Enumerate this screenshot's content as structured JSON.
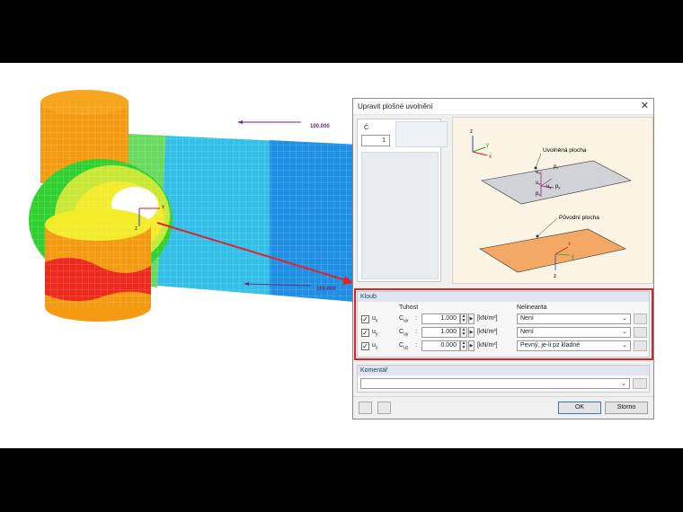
{
  "load_labels": [
    "100.000",
    "100.000"
  ],
  "model_axes": {
    "x": "x",
    "z": "z"
  },
  "dialog": {
    "title": "Upravit plošné uvolnění",
    "close_icon": "close-icon",
    "number_label": "Č",
    "number_value": "1",
    "illustration": {
      "released_surface": "Uvolněná plocha",
      "original_surface": "Původní plocha",
      "axis_z": "z",
      "axis_y": "y",
      "axis_x": "x",
      "u_x": "u",
      "p_x": "p",
      "u_z": "u",
      "u_y": "u",
      "p_y": "p",
      "p_z": "p",
      "sub_x": "x",
      "sub_y": "y",
      "sub_z": "z"
    },
    "hinge": {
      "section_title": "Kloub",
      "col_stiffness": "Tuhost",
      "col_nonlinearity": "Nelinearita",
      "rows": [
        {
          "checked": "✓",
          "dof": "u",
          "dof_sub": "x",
          "c": "C",
          "c_sub": "ux",
          "colon": ":",
          "value": "1.000",
          "unit": "[kN/m³]",
          "nonlinearity": "Není"
        },
        {
          "checked": "✓",
          "dof": "u",
          "dof_sub": "y",
          "c": "C",
          "c_sub": "uy",
          "colon": ":",
          "value": "1.000",
          "unit": "[kN/m³]",
          "nonlinearity": "Není"
        },
        {
          "checked": "✓",
          "dof": "u",
          "dof_sub": "z",
          "c": "C",
          "c_sub": "uz",
          "colon": ":",
          "value": "0.000",
          "unit": "[kN/m³]",
          "nonlinearity": "Pevný, je-li pz kladné"
        }
      ]
    },
    "comment": {
      "section_title": "Komentář",
      "value": ""
    },
    "buttons": {
      "ok": "OK",
      "cancel": "Storno"
    }
  },
  "colors": {
    "highlight": "#e0232b",
    "accent": "#2b7bd8"
  }
}
